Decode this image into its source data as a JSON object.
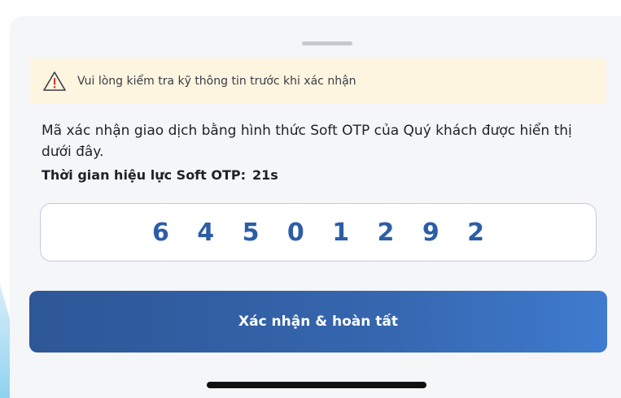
{
  "warning": {
    "text": "Vui lòng kiểm tra kỹ thông tin trước khi xác nhận",
    "icon": "warning-triangle-icon",
    "color": "#d63b2f"
  },
  "description": "Mã xác nhận giao dịch bằng hình thức Soft OTP của Quý khách được hiển thị dưới đây.",
  "validity": {
    "label": "Thời gian hiệu lực Soft OTP:",
    "seconds": "21s"
  },
  "otp": {
    "code": "6 4 5 0 1 2 9 2"
  },
  "confirm_button": {
    "label": "Xác nhận & hoàn tất"
  },
  "colors": {
    "accent": "#2c5ea7",
    "banner": "#fdf5e0",
    "sheet": "#f5f6f8"
  }
}
